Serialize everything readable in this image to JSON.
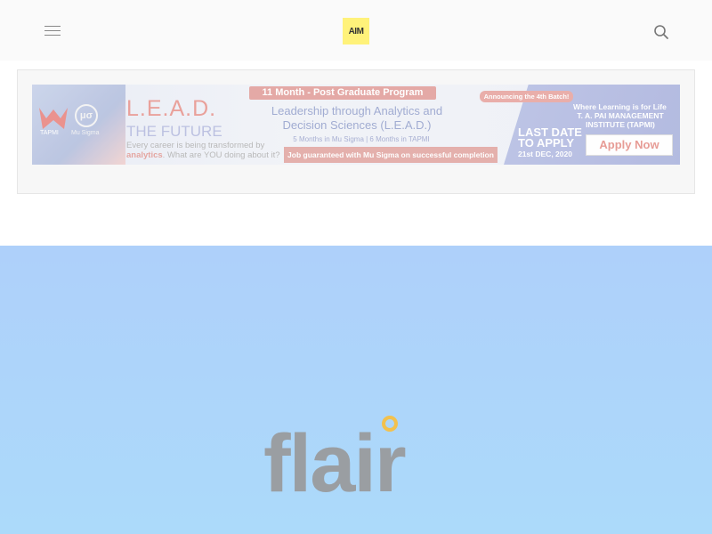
{
  "header": {
    "logo_text": "AIM",
    "menu_icon": "hamburger-menu-icon",
    "search_icon": "search-icon"
  },
  "ad": {
    "brand_left": "TAPMI",
    "brand_mu": "μσ",
    "brand_mu_label": "Mu Sigma",
    "lead_title": "L.E.A.D.",
    "future": "THE FUTURE",
    "every_career": "Every career is being transformed by",
    "analytics_word": "analytics",
    "what_are_you": ". What are YOU doing about it?",
    "program": "11 Month - Post Graduate Program",
    "leadership": "Leadership through Analytics and Decision Sciences (L.E.A.D.)",
    "months": "5 Months in Mu Sigma | 6 Months in TAPMI",
    "guarantee": "Job guaranteed with Mu Sigma on successful completion",
    "announce": "Announcing the 4th Batch!",
    "where": "Where Learning is for Life",
    "institute": "T. A. PAI MANAGEMENT INSTITUTE (TAPMI)",
    "last_date_1": "LAST DATE",
    "last_date_2": "TO APPLY",
    "deadline": "21st DEC, 2020",
    "apply_button": "Apply Now"
  },
  "hero": {
    "brand_letters": "flair",
    "background_color": "#aed0fa"
  }
}
